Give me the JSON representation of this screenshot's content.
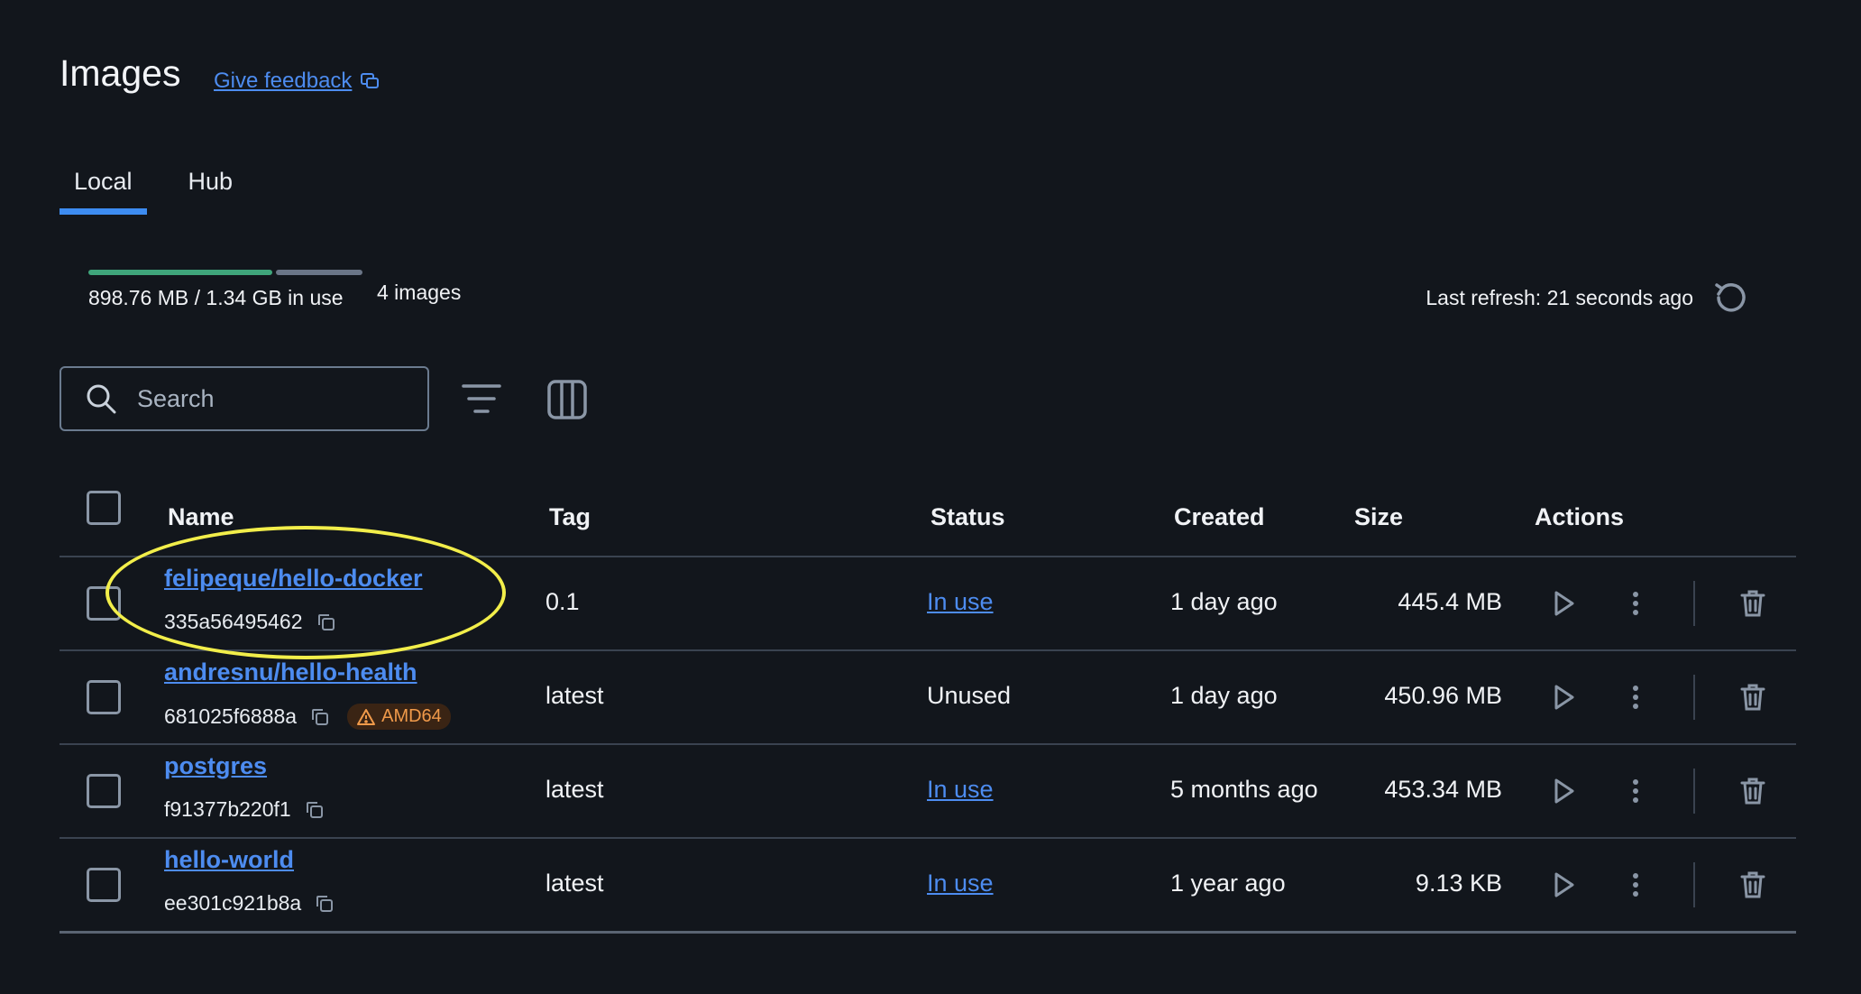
{
  "header": {
    "title": "Images",
    "feedback_label": "Give feedback"
  },
  "tabs": [
    {
      "label": "Local",
      "active": true
    },
    {
      "label": "Hub",
      "active": false
    }
  ],
  "usage": {
    "text": "898.76 MB / 1.34 GB in use",
    "images_count": "4 images",
    "fraction_used": 0.67,
    "used_color": "#3fa57b"
  },
  "refresh": {
    "label": "Last refresh: 21 seconds ago"
  },
  "search": {
    "placeholder": "Search",
    "value": ""
  },
  "table": {
    "columns": [
      "Name",
      "Tag",
      "Status",
      "Created",
      "Size",
      "Actions"
    ],
    "rows": [
      {
        "name": "felipeque/hello-docker",
        "id": "335a56495462",
        "tag": "0.1",
        "status": "In use",
        "created": "1 day ago",
        "size": "445.4 MB",
        "badge": ""
      },
      {
        "name": "andresnu/hello-health",
        "id": "681025f6888a",
        "tag": "latest",
        "status": "Unused",
        "created": "1 day ago",
        "size": "450.96 MB",
        "badge": "AMD64"
      },
      {
        "name": "postgres",
        "id": "f91377b220f1",
        "tag": "latest",
        "status": "In use",
        "created": "5 months ago",
        "size": "453.34 MB",
        "badge": ""
      },
      {
        "name": "hello-world",
        "id": "ee301c921b8a",
        "tag": "latest",
        "status": "In use",
        "created": "1 year ago",
        "size": "9.13 KB",
        "badge": ""
      }
    ]
  },
  "colors": {
    "background": "#12161c",
    "accent": "#3d8cf1",
    "link": "#4d8cf0",
    "warning": "#f09a4a",
    "highlight": "#f2ee4a"
  }
}
